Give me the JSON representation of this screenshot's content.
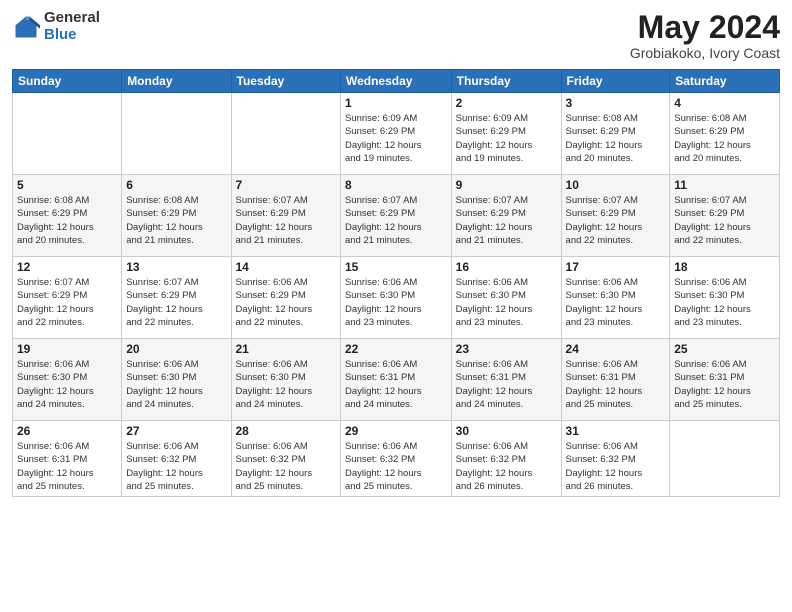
{
  "logo": {
    "general": "General",
    "blue": "Blue"
  },
  "title": {
    "month_year": "May 2024",
    "location": "Grobiakoko, Ivory Coast"
  },
  "headers": [
    "Sunday",
    "Monday",
    "Tuesday",
    "Wednesday",
    "Thursday",
    "Friday",
    "Saturday"
  ],
  "weeks": [
    [
      {
        "day": "",
        "info": ""
      },
      {
        "day": "",
        "info": ""
      },
      {
        "day": "",
        "info": ""
      },
      {
        "day": "1",
        "info": "Sunrise: 6:09 AM\nSunset: 6:29 PM\nDaylight: 12 hours\nand 19 minutes."
      },
      {
        "day": "2",
        "info": "Sunrise: 6:09 AM\nSunset: 6:29 PM\nDaylight: 12 hours\nand 19 minutes."
      },
      {
        "day": "3",
        "info": "Sunrise: 6:08 AM\nSunset: 6:29 PM\nDaylight: 12 hours\nand 20 minutes."
      },
      {
        "day": "4",
        "info": "Sunrise: 6:08 AM\nSunset: 6:29 PM\nDaylight: 12 hours\nand 20 minutes."
      }
    ],
    [
      {
        "day": "5",
        "info": "Sunrise: 6:08 AM\nSunset: 6:29 PM\nDaylight: 12 hours\nand 20 minutes."
      },
      {
        "day": "6",
        "info": "Sunrise: 6:08 AM\nSunset: 6:29 PM\nDaylight: 12 hours\nand 21 minutes."
      },
      {
        "day": "7",
        "info": "Sunrise: 6:07 AM\nSunset: 6:29 PM\nDaylight: 12 hours\nand 21 minutes."
      },
      {
        "day": "8",
        "info": "Sunrise: 6:07 AM\nSunset: 6:29 PM\nDaylight: 12 hours\nand 21 minutes."
      },
      {
        "day": "9",
        "info": "Sunrise: 6:07 AM\nSunset: 6:29 PM\nDaylight: 12 hours\nand 21 minutes."
      },
      {
        "day": "10",
        "info": "Sunrise: 6:07 AM\nSunset: 6:29 PM\nDaylight: 12 hours\nand 22 minutes."
      },
      {
        "day": "11",
        "info": "Sunrise: 6:07 AM\nSunset: 6:29 PM\nDaylight: 12 hours\nand 22 minutes."
      }
    ],
    [
      {
        "day": "12",
        "info": "Sunrise: 6:07 AM\nSunset: 6:29 PM\nDaylight: 12 hours\nand 22 minutes."
      },
      {
        "day": "13",
        "info": "Sunrise: 6:07 AM\nSunset: 6:29 PM\nDaylight: 12 hours\nand 22 minutes."
      },
      {
        "day": "14",
        "info": "Sunrise: 6:06 AM\nSunset: 6:29 PM\nDaylight: 12 hours\nand 22 minutes."
      },
      {
        "day": "15",
        "info": "Sunrise: 6:06 AM\nSunset: 6:30 PM\nDaylight: 12 hours\nand 23 minutes."
      },
      {
        "day": "16",
        "info": "Sunrise: 6:06 AM\nSunset: 6:30 PM\nDaylight: 12 hours\nand 23 minutes."
      },
      {
        "day": "17",
        "info": "Sunrise: 6:06 AM\nSunset: 6:30 PM\nDaylight: 12 hours\nand 23 minutes."
      },
      {
        "day": "18",
        "info": "Sunrise: 6:06 AM\nSunset: 6:30 PM\nDaylight: 12 hours\nand 23 minutes."
      }
    ],
    [
      {
        "day": "19",
        "info": "Sunrise: 6:06 AM\nSunset: 6:30 PM\nDaylight: 12 hours\nand 24 minutes."
      },
      {
        "day": "20",
        "info": "Sunrise: 6:06 AM\nSunset: 6:30 PM\nDaylight: 12 hours\nand 24 minutes."
      },
      {
        "day": "21",
        "info": "Sunrise: 6:06 AM\nSunset: 6:30 PM\nDaylight: 12 hours\nand 24 minutes."
      },
      {
        "day": "22",
        "info": "Sunrise: 6:06 AM\nSunset: 6:31 PM\nDaylight: 12 hours\nand 24 minutes."
      },
      {
        "day": "23",
        "info": "Sunrise: 6:06 AM\nSunset: 6:31 PM\nDaylight: 12 hours\nand 24 minutes."
      },
      {
        "day": "24",
        "info": "Sunrise: 6:06 AM\nSunset: 6:31 PM\nDaylight: 12 hours\nand 25 minutes."
      },
      {
        "day": "25",
        "info": "Sunrise: 6:06 AM\nSunset: 6:31 PM\nDaylight: 12 hours\nand 25 minutes."
      }
    ],
    [
      {
        "day": "26",
        "info": "Sunrise: 6:06 AM\nSunset: 6:31 PM\nDaylight: 12 hours\nand 25 minutes."
      },
      {
        "day": "27",
        "info": "Sunrise: 6:06 AM\nSunset: 6:32 PM\nDaylight: 12 hours\nand 25 minutes."
      },
      {
        "day": "28",
        "info": "Sunrise: 6:06 AM\nSunset: 6:32 PM\nDaylight: 12 hours\nand 25 minutes."
      },
      {
        "day": "29",
        "info": "Sunrise: 6:06 AM\nSunset: 6:32 PM\nDaylight: 12 hours\nand 25 minutes."
      },
      {
        "day": "30",
        "info": "Sunrise: 6:06 AM\nSunset: 6:32 PM\nDaylight: 12 hours\nand 26 minutes."
      },
      {
        "day": "31",
        "info": "Sunrise: 6:06 AM\nSunset: 6:32 PM\nDaylight: 12 hours\nand 26 minutes."
      },
      {
        "day": "",
        "info": ""
      }
    ]
  ]
}
